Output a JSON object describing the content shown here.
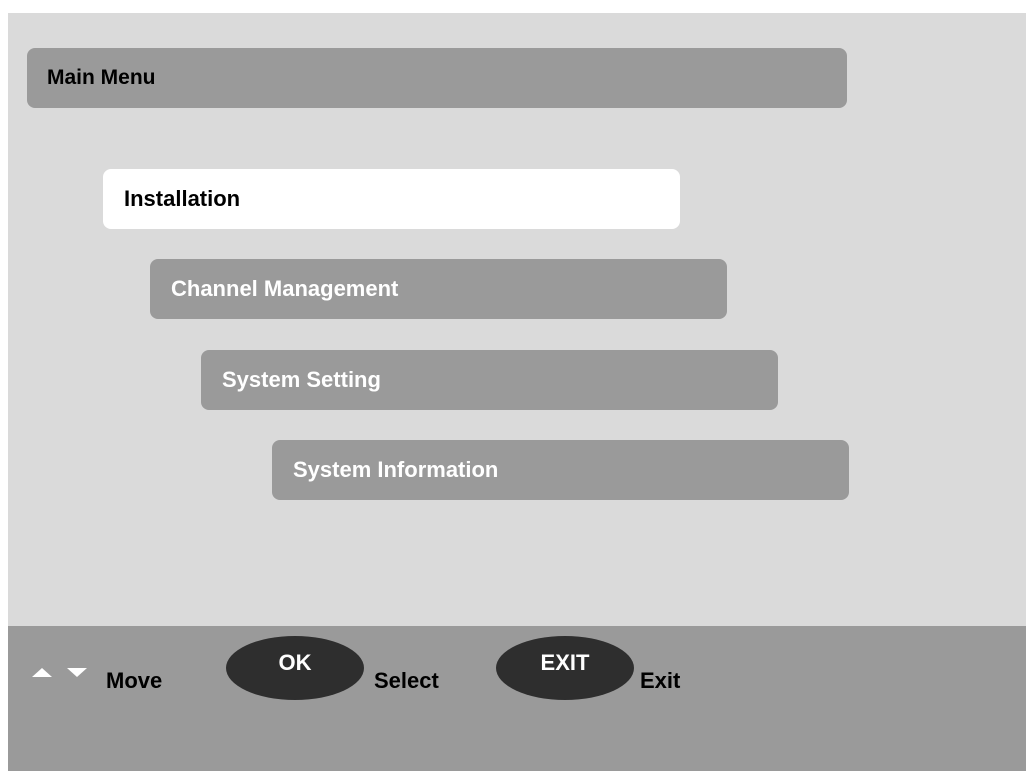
{
  "header": {
    "title": "Main Menu"
  },
  "menu": {
    "items": [
      {
        "label": "Installation",
        "selected": true
      },
      {
        "label": "Channel Management",
        "selected": false
      },
      {
        "label": "System Setting",
        "selected": false
      },
      {
        "label": "System Information",
        "selected": false
      }
    ]
  },
  "footer": {
    "move_icons": [
      "up-arrow-icon",
      "down-arrow-icon"
    ],
    "move_label": "Move",
    "ok_key": "OK",
    "select_label": "Select",
    "exit_key": "EXIT",
    "exit_label": "Exit"
  },
  "colors": {
    "background": "#dadada",
    "panel": "#9a9a9a",
    "selected": "#ffffff",
    "key_button": "#2e2e2e"
  }
}
